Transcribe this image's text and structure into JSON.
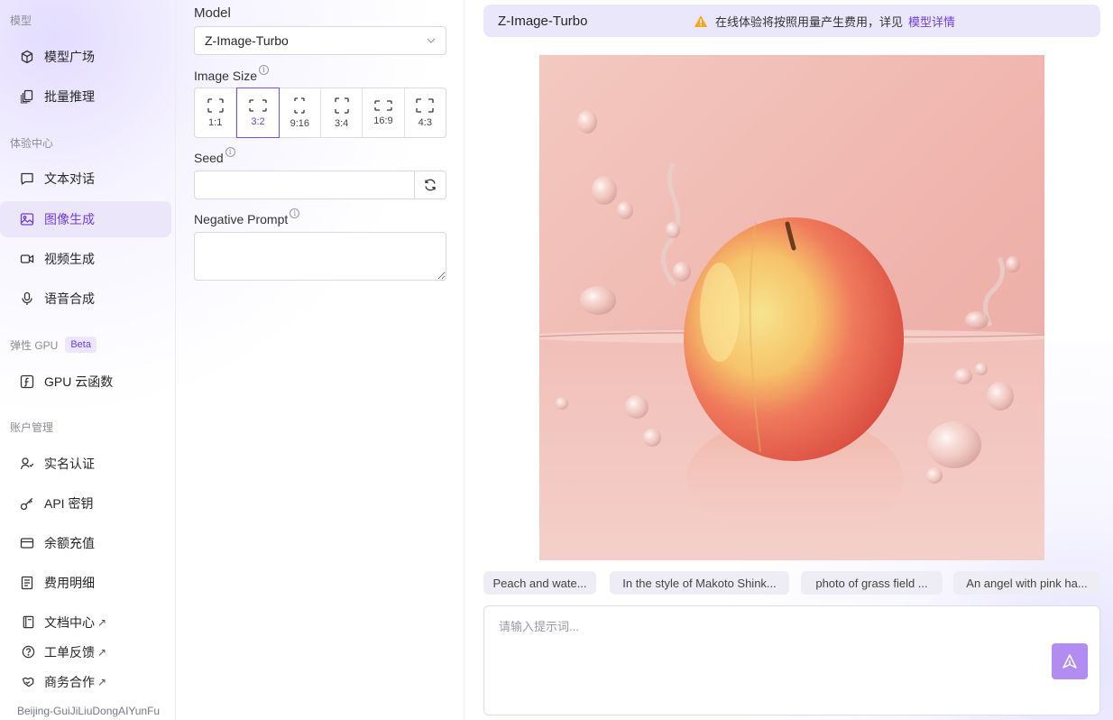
{
  "sidebar": {
    "sections": {
      "models": "模型",
      "experience": "体验中心",
      "elastic_gpu": "弹性 GPU",
      "beta": "Beta",
      "account": "账户管理"
    },
    "items": {
      "model_square": "模型广场",
      "batch_inference": "批量推理",
      "text_chat": "文本对话",
      "image_gen": "图像生成",
      "video_gen": "视频生成",
      "speech_synth": "语音合成",
      "gpu_functions": "GPU 云函数",
      "real_name": "实名认证",
      "api_keys": "API 密钥",
      "recharge": "余额充值",
      "billing": "费用明细"
    },
    "links": {
      "docs": "文档中心",
      "tickets": "工单反馈",
      "business": "商务合作",
      "ext_arrow": "↗"
    },
    "region": "Beijing-GuiJiLiuDongAIYunFu"
  },
  "panel": {
    "model_label": "Model",
    "model_value": "Z-Image-Turbo",
    "image_size_label": "Image Size",
    "sizes": [
      "1:1",
      "3:2",
      "9:16",
      "3:4",
      "16:9",
      "4:3"
    ],
    "selected_size": "3:2",
    "seed_label": "Seed",
    "seed_value": "",
    "negative_prompt_label": "Negative Prompt",
    "negative_prompt_value": ""
  },
  "topbar": {
    "model_name": "Z-Image-Turbo",
    "notice": "在线体验将按照用量产生费用，详见",
    "notice_link": "模型详情"
  },
  "suggestions": [
    "Peach and wate...",
    "In the style of Makoto Shink...",
    "photo of grass field ...",
    "An angel with pink ha..."
  ],
  "prompt": {
    "placeholder": "请输入提示词..."
  },
  "colors": {
    "accent": "#6f3fd8",
    "active_bg": "#ece6fb",
    "topbar_bg": "#ebe7fb",
    "send_button": "#b28cf0",
    "warning": "#f5a623"
  }
}
